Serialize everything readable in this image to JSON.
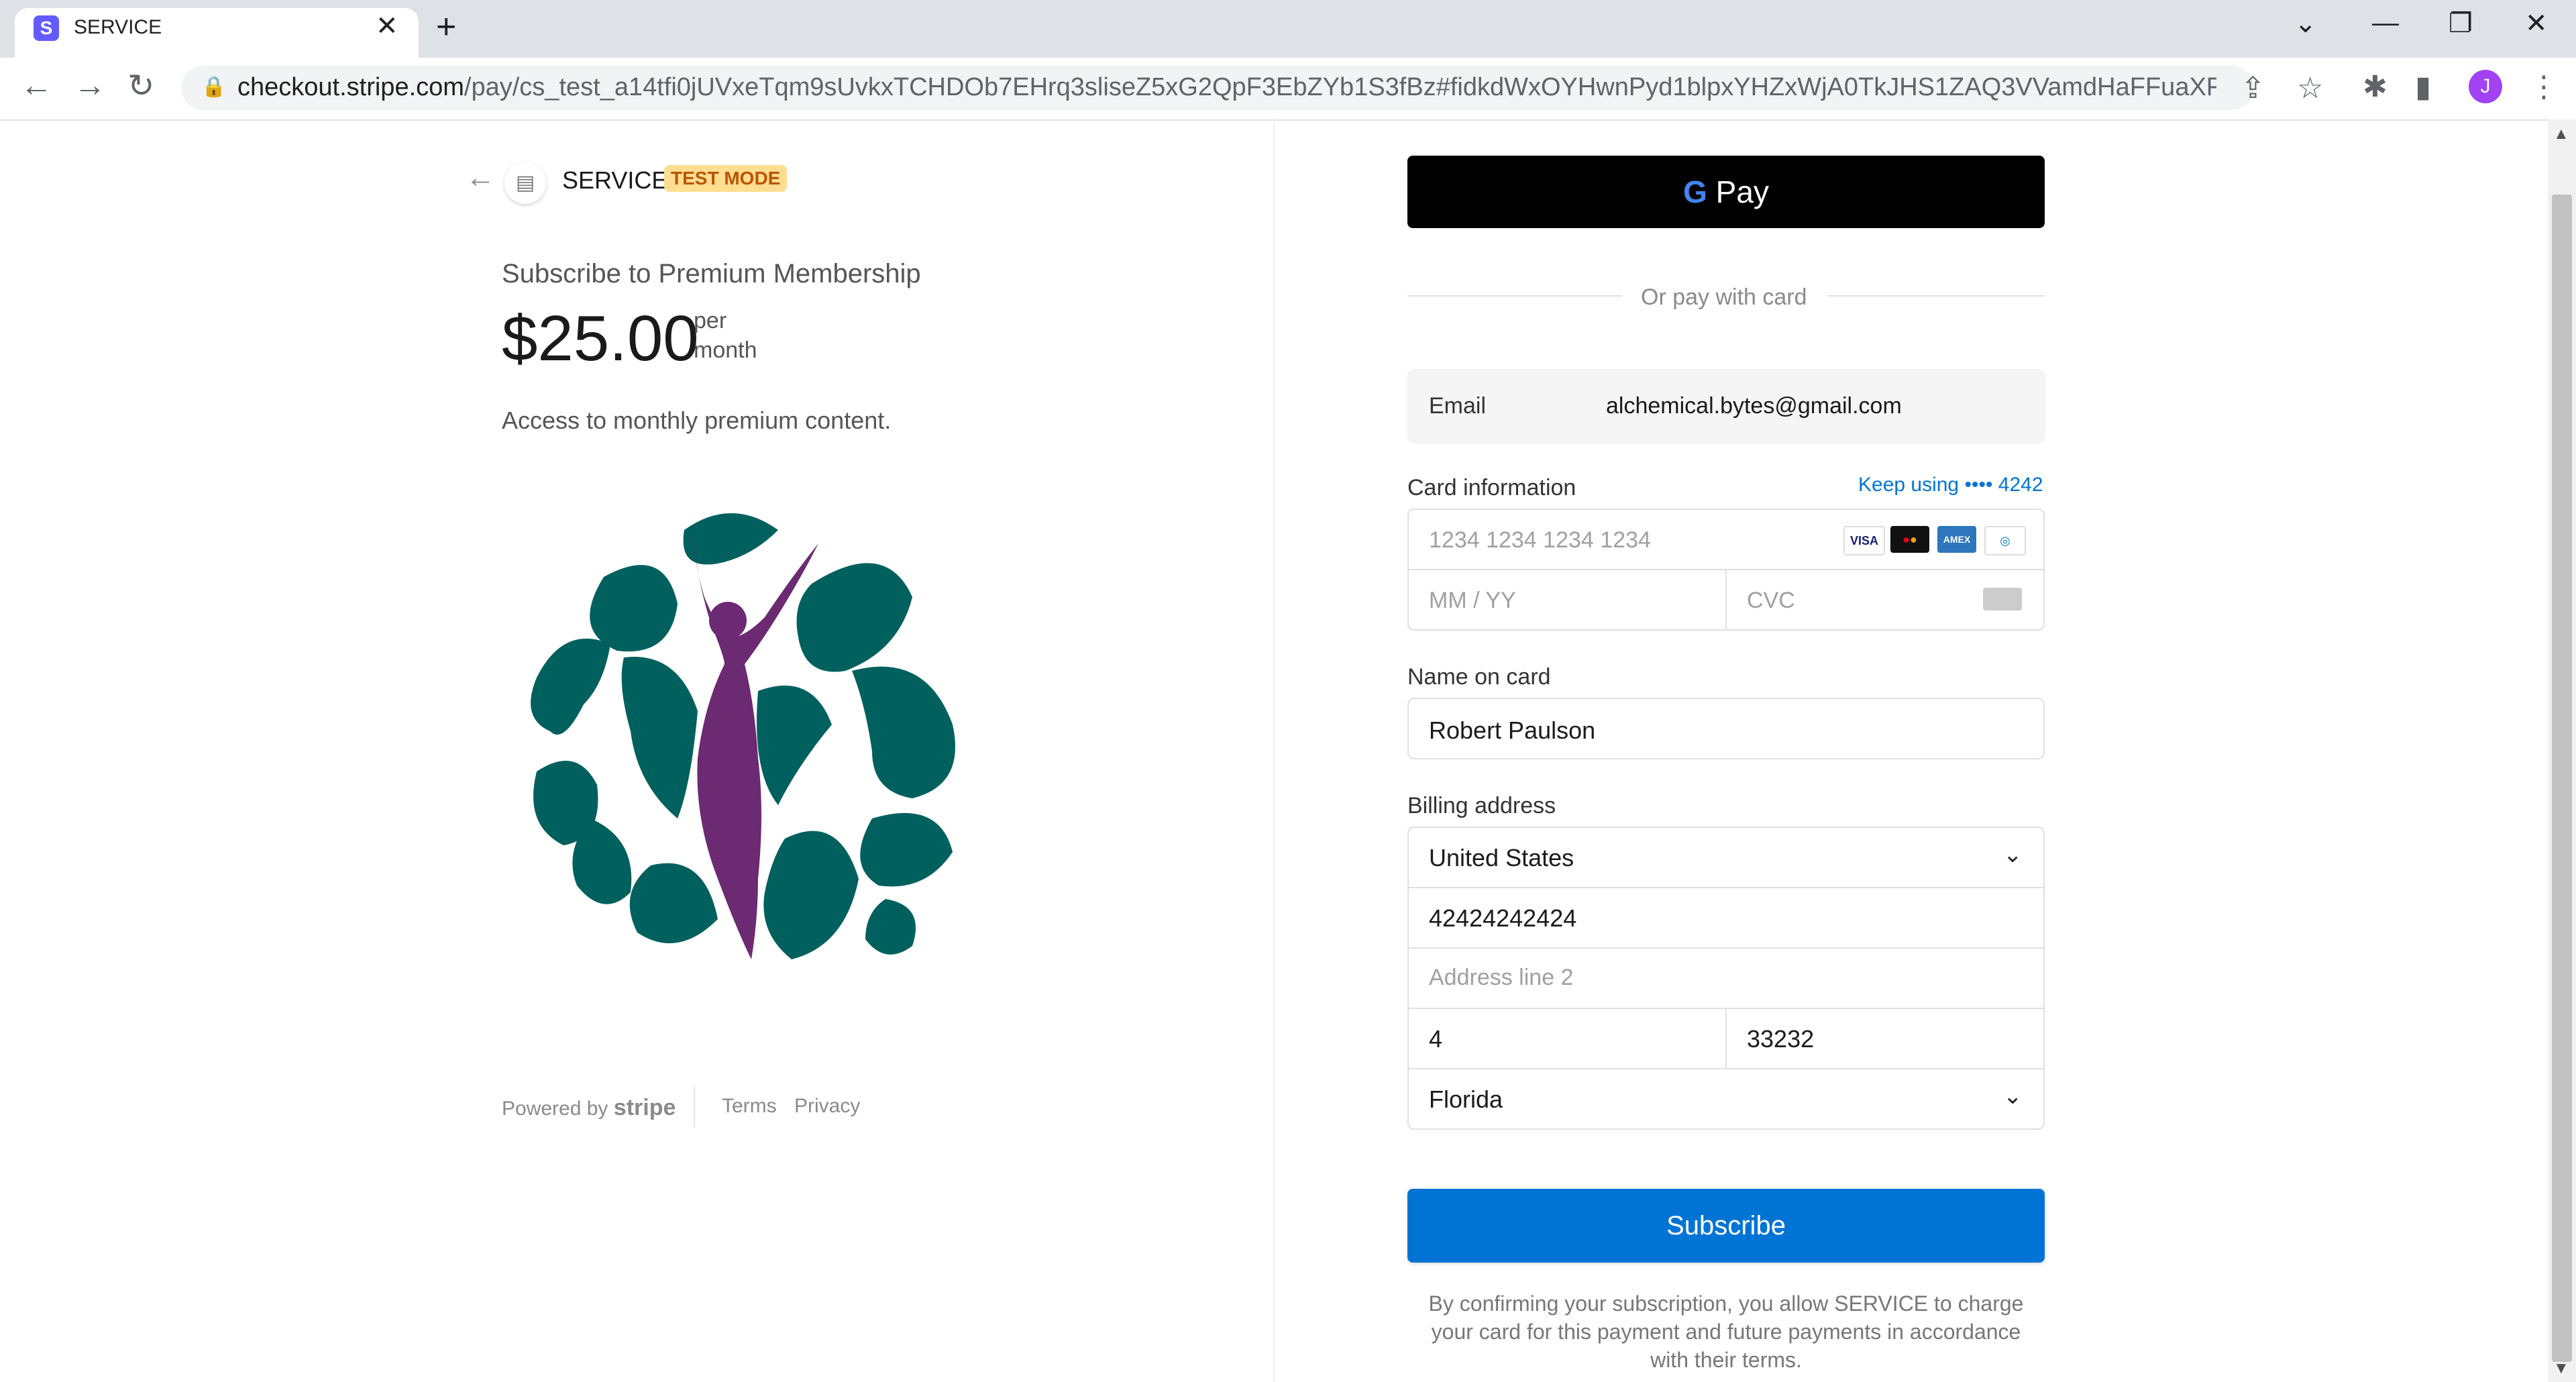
{
  "browser": {
    "tab_title": "SERVICE",
    "tab_favicon_letter": "S",
    "url_host": "checkout.stripe.com",
    "url_path": "/pay/cs_test_a14tfi0jUVxeTqm9sUvkxTCHDOb7EHrq3sliseZ5xG2QpF3EbZYb1S3fBz#fidkdWxOYHwnPyd1blpxYHZxWjA0TkJHS1ZAQ3VVamdHaFFuaXFKZjRtPFNcc390b3xlV...",
    "avatar_letter": "J"
  },
  "left": {
    "merchant": "SERVICE",
    "test_mode": "TEST MODE",
    "product": "Subscribe to Premium Membership",
    "price": "$25.00",
    "per_line1": "per",
    "per_line2": "month",
    "description": "Access to monthly premium content.",
    "powered_by": "Powered by",
    "stripe": "stripe",
    "terms": "Terms",
    "privacy": "Privacy"
  },
  "right": {
    "gpay_g": "G",
    "gpay_pay": "Pay",
    "or_pay": "Or pay with card",
    "email_label": "Email",
    "email_value": "alchemical.bytes@gmail.com",
    "card_label": "Card information",
    "keep_using": "Keep using •••• 4242",
    "card_placeholder": "1234 1234 1234 1234",
    "expiry_placeholder": "MM / YY",
    "cvc_placeholder": "CVC",
    "brands": [
      "VISA",
      "MC",
      "AMEX",
      "DC"
    ],
    "name_label": "Name on card",
    "name_value": "Robert Paulson",
    "billing_label": "Billing address",
    "country": "United States",
    "address1": "42424242424",
    "address2_placeholder": "Address line 2",
    "city": "4",
    "zip": "33232",
    "state": "Florida",
    "subscribe": "Subscribe",
    "confirm_text": "By confirming your subscription, you allow SERVICE to charge your card for this payment and future payments in accordance with their terms."
  },
  "colors": {
    "accent": "#0074d4",
    "stripe_brand": "#635bff",
    "test_mode_bg": "#ffde92",
    "logo_teal": "#00605e",
    "logo_purple": "#6b2a72"
  }
}
